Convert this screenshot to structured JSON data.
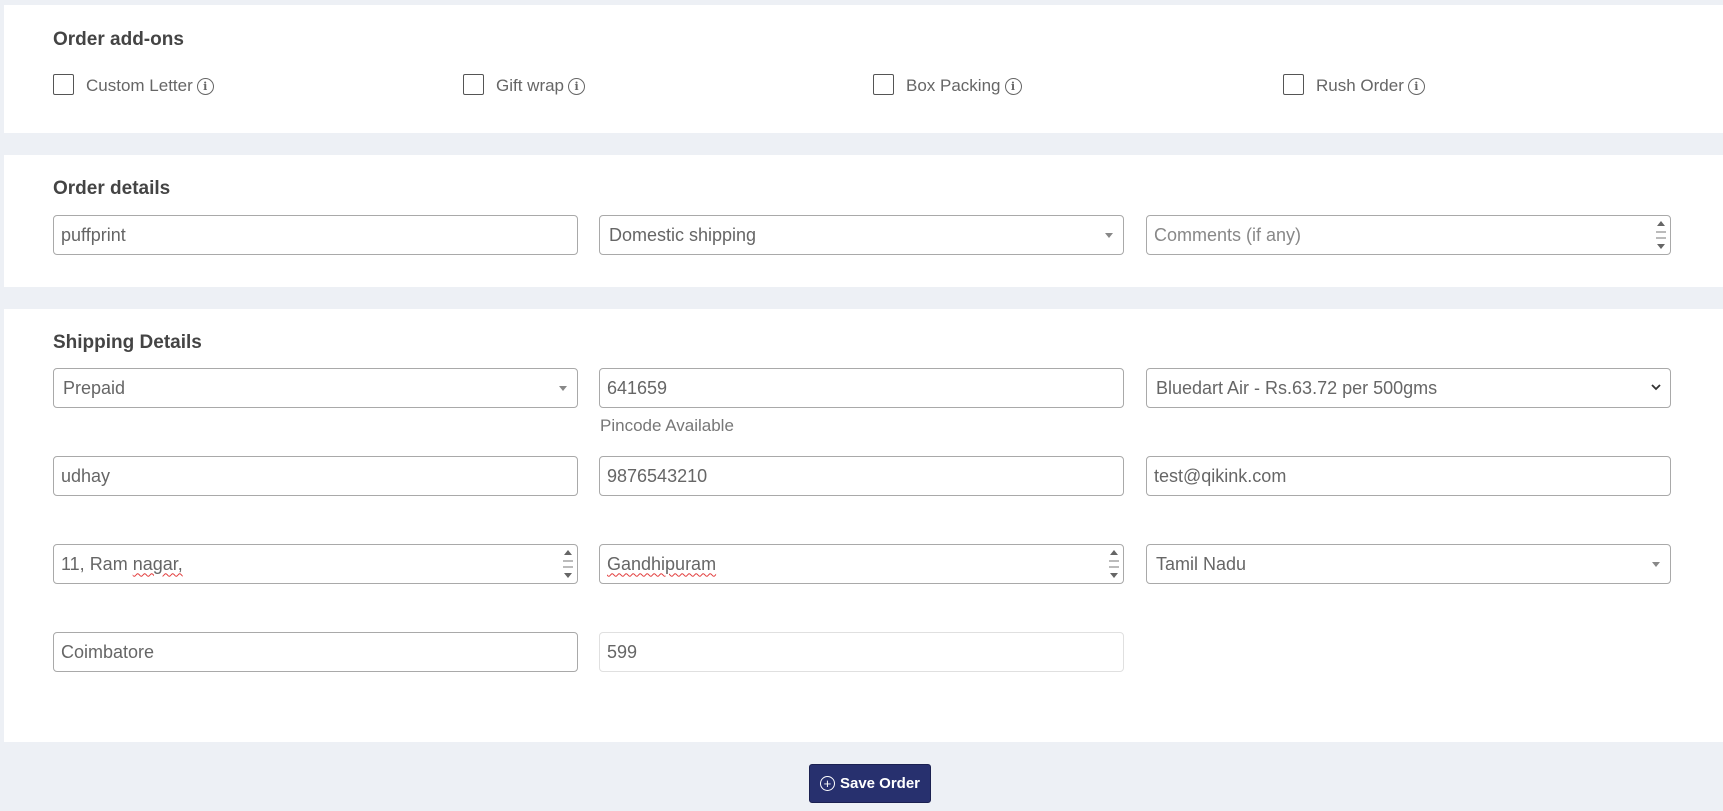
{
  "addons": {
    "title": "Order add-ons",
    "options": [
      {
        "label": "Custom Letter",
        "checked": false
      },
      {
        "label": "Gift wrap",
        "checked": false
      },
      {
        "label": "Box Packing",
        "checked": false
      },
      {
        "label": "Rush Order",
        "checked": false
      }
    ],
    "info_icon": "info-circle-icon"
  },
  "order_details": {
    "title": "Order details",
    "order_number": "puffprint",
    "shipping_type": "Domestic shipping",
    "comments_placeholder": "Comments (if any)"
  },
  "shipping_details": {
    "title": "Shipping Details",
    "payment_mode": "Prepaid",
    "pincode": "641659",
    "pincode_status": "Pincode Available",
    "courier": "Bluedart Air - Rs.63.72 per 500gms",
    "name": "udhay",
    "phone": "9876543210",
    "email": "test@qikink.com",
    "address_line1_prefix": "11, Ram ",
    "address_line1_word": "nagar,",
    "address_line2": "Gandhipuram",
    "state": "Tamil Nadu",
    "city": "Coimbatore",
    "amount": "599"
  },
  "actions": {
    "save_label": "Save Order",
    "save_icon": "plus-circle-icon"
  },
  "colors": {
    "page_bg": "#edf0f5",
    "card_bg": "#ffffff",
    "button_bg": "#27306e",
    "spellcheck_underline": "#e23b3b"
  }
}
